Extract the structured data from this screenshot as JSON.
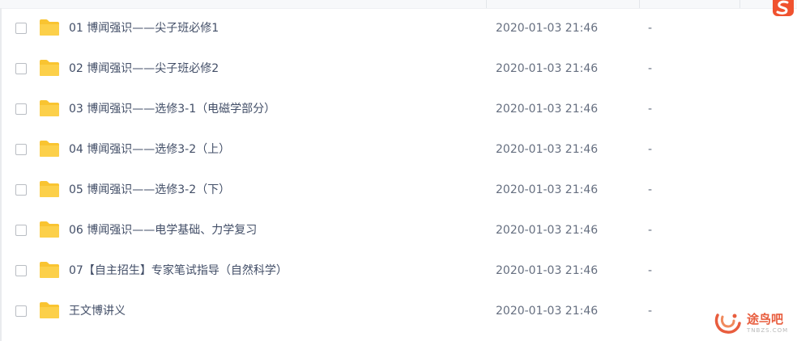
{
  "files": [
    {
      "name": "01 博闻强识——尖子班必修1",
      "date": "2020-01-03 21:46",
      "size": "-"
    },
    {
      "name": "02 博闻强识——尖子班必修2",
      "date": "2020-01-03 21:46",
      "size": "-"
    },
    {
      "name": "03 博闻强识——选修3-1（电磁学部分）",
      "date": "2020-01-03 21:46",
      "size": "-"
    },
    {
      "name": "04 博闻强识——选修3-2（上）",
      "date": "2020-01-03 21:46",
      "size": "-"
    },
    {
      "name": "05 博闻强识——选修3-2（下）",
      "date": "2020-01-03 21:46",
      "size": "-"
    },
    {
      "name": "06 博闻强识——电学基础、力学复习",
      "date": "2020-01-03 21:46",
      "size": "-"
    },
    {
      "name": "07【自主招生】专家笔试指导（自然科学）",
      "date": "2020-01-03 21:46",
      "size": "-"
    },
    {
      "name": "王文博讲义",
      "date": "2020-01-03 21:46",
      "size": "-"
    }
  ],
  "icons": {
    "folder": "folder-icon",
    "corner_logo": "sogou-logo-icon",
    "watermark_logo": "watermark-logo-icon"
  },
  "colors": {
    "folder": "#f9c431",
    "text": "#424e67",
    "meta": "#666f80",
    "watermark": "#e85d3e"
  },
  "watermark": {
    "text": "途鸟吧",
    "sub": "TNBZS.COM"
  }
}
